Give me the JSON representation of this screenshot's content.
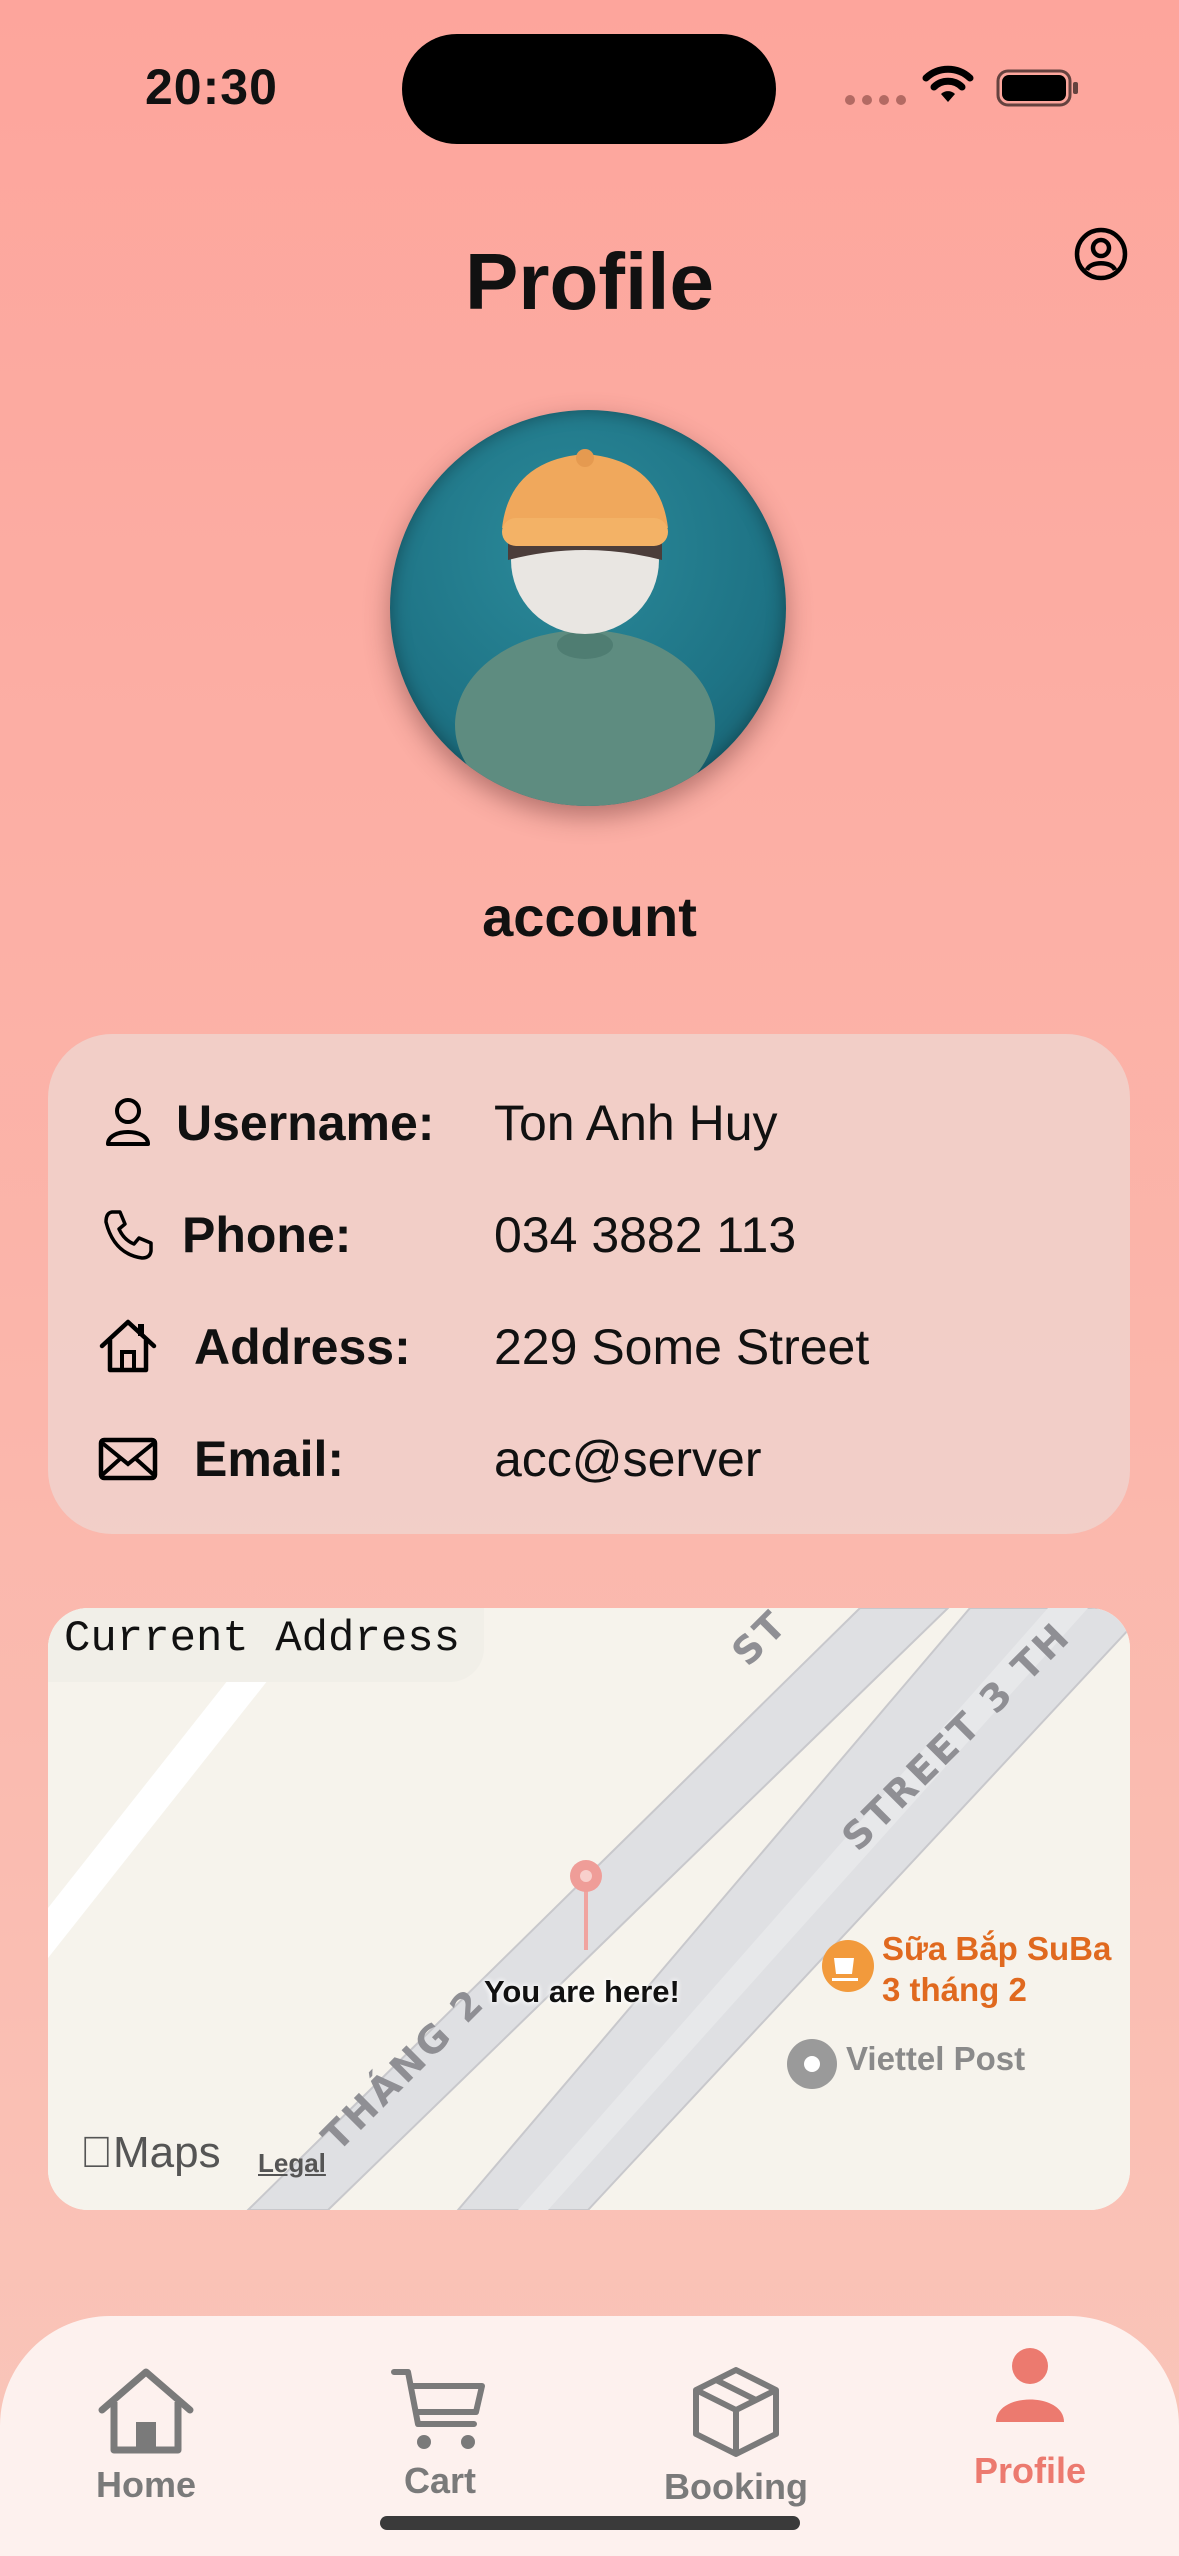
{
  "status_bar": {
    "time": "20:30"
  },
  "header": {
    "title": "Profile",
    "account_icon": "person-circle-icon"
  },
  "profile": {
    "name": "account",
    "avatar": "avatar-illustration"
  },
  "info": {
    "username": {
      "label": "Username:",
      "value": "Ton Anh Huy",
      "icon": "person-icon"
    },
    "phone": {
      "label": "Phone:",
      "value": "034 3882 113",
      "icon": "phone-icon"
    },
    "address": {
      "label": "Address:",
      "value": "229 Some Street",
      "icon": "house-icon"
    },
    "email": {
      "label": "Email:",
      "value": "acc@server",
      "icon": "envelope-icon"
    }
  },
  "map": {
    "label": "Current Address",
    "pin_label": "You are here!",
    "street_a": "THÁNG 2",
    "street_b": "STREET 3 TH",
    "street_c": "ST",
    "poi_cafe_line1": "Sữa Bắp SuBa",
    "poi_cafe_line2": "3 tháng 2",
    "poi_viettel": "Viettel Post",
    "maps_brand": "Maps",
    "legal": "Legal"
  },
  "tabs": [
    {
      "label": "Home",
      "icon": "house-icon",
      "active": false
    },
    {
      "label": "Cart",
      "icon": "cart-icon",
      "active": false
    },
    {
      "label": "Booking",
      "icon": "box-icon",
      "active": false
    },
    {
      "label": "Profile",
      "icon": "person-fill-icon",
      "active": true
    }
  ],
  "colors": {
    "accent": "#ec7a6f",
    "inactive": "#7a7a7a",
    "poi_orange": "#e0691f"
  }
}
